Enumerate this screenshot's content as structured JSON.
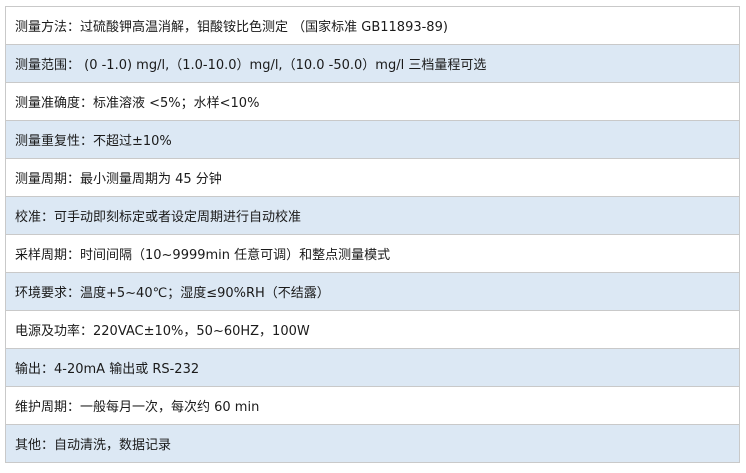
{
  "rows": [
    {
      "text": "测量方法：过硫酸钾高温消解，钼酸铵比色测定 （国家标准 GB11893-89)"
    },
    {
      "text": "测量范围： (0 -1.0) mg/l,（1.0-10.0）mg/l,（10.0 -50.0）mg/l 三档量程可选"
    },
    {
      "text": "测量准确度：标准溶液 <5%；水样<10%"
    },
    {
      "text": "测量重复性：不超过±10%"
    },
    {
      "text": "测量周期：最小测量周期为 45 分钟"
    },
    {
      "text": "校准：可手动即刻标定或者设定周期进行自动校准"
    },
    {
      "text": "采样周期：时间间隔（10~9999min 任意可调）和整点测量模式"
    },
    {
      "text": "环境要求：温度+5~40℃；湿度≤90%RH（不结露）"
    },
    {
      "text": "电源及功率：220VAC±10%，50~60HZ，100W"
    },
    {
      "text": "输出：4-20mA 输出或 RS-232"
    },
    {
      "text": "维护周期：一般每月一次，每次约 60 min"
    },
    {
      "text": "其他：自动清洗，数据记录"
    }
  ],
  "colors": {
    "row_odd": "#ffffff",
    "row_even": "#dce8f4",
    "border": "#c9c9c9",
    "text": "#1a1a1a"
  }
}
